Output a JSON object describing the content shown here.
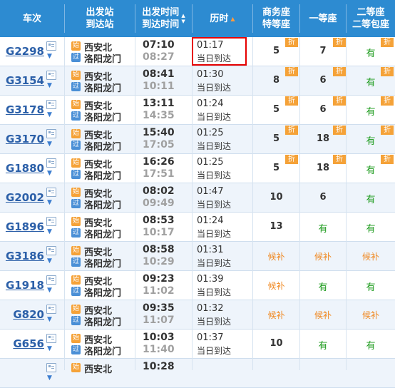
{
  "header": {
    "train_no": "车次",
    "station_l1": "出发站",
    "station_l2": "到达站",
    "time_l1": "出发时间",
    "time_l2": "到达时间",
    "duration": "历时",
    "business_l1": "商务座",
    "business_l2": "特等座",
    "first_class": "一等座",
    "second_l1": "二等座",
    "second_l2": "二等包座"
  },
  "badges": {
    "start": "始",
    "via": "过"
  },
  "discount_label": "折",
  "rows": [
    {
      "train": "G2298",
      "from": "西安北",
      "to": "洛阳龙门",
      "dep": "07:10",
      "arr": "08:27",
      "dur": "01:17",
      "arrive_day": "当日到达",
      "business": "5",
      "first": "7",
      "second": "有",
      "disc_b": true,
      "disc_f": true,
      "disc_s": true
    },
    {
      "train": "G3154",
      "from": "西安北",
      "to": "洛阳龙门",
      "dep": "08:41",
      "arr": "10:11",
      "dur": "01:30",
      "arrive_day": "当日到达",
      "business": "8",
      "first": "6",
      "second": "有",
      "disc_b": true,
      "disc_f": true,
      "disc_s": true
    },
    {
      "train": "G3178",
      "from": "西安北",
      "to": "洛阳龙门",
      "dep": "13:11",
      "arr": "14:35",
      "dur": "01:24",
      "arrive_day": "当日到达",
      "business": "5",
      "first": "6",
      "second": "有",
      "disc_b": true,
      "disc_f": true,
      "disc_s": true
    },
    {
      "train": "G3170",
      "from": "西安北",
      "to": "洛阳龙门",
      "dep": "15:40",
      "arr": "17:05",
      "dur": "01:25",
      "arrive_day": "当日到达",
      "business": "5",
      "first": "18",
      "second": "有",
      "disc_b": true,
      "disc_f": true,
      "disc_s": true
    },
    {
      "train": "G1880",
      "from": "西安北",
      "to": "洛阳龙门",
      "dep": "16:26",
      "arr": "17:51",
      "dur": "01:25",
      "arrive_day": "当日到达",
      "business": "5",
      "first": "18",
      "second": "有",
      "disc_b": true,
      "disc_f": true,
      "disc_s": true
    },
    {
      "train": "G2002",
      "from": "西安北",
      "to": "洛阳龙门",
      "dep": "08:02",
      "arr": "09:49",
      "dur": "01:47",
      "arrive_day": "当日到达",
      "business": "10",
      "first": "6",
      "second": "有",
      "disc_b": false,
      "disc_f": false,
      "disc_s": false
    },
    {
      "train": "G1896",
      "from": "西安北",
      "to": "洛阳龙门",
      "dep": "08:53",
      "arr": "10:17",
      "dur": "01:24",
      "arrive_day": "当日到达",
      "business": "13",
      "first": "有",
      "second": "有",
      "disc_b": false,
      "disc_f": false,
      "disc_s": false
    },
    {
      "train": "G3186",
      "from": "西安北",
      "to": "洛阳龙门",
      "dep": "08:58",
      "arr": "10:29",
      "dur": "01:31",
      "arrive_day": "当日到达",
      "business": "候补",
      "first": "候补",
      "second": "候补",
      "disc_b": false,
      "disc_f": false,
      "disc_s": false
    },
    {
      "train": "G1918",
      "from": "西安北",
      "to": "洛阳龙门",
      "dep": "09:23",
      "arr": "11:02",
      "dur": "01:39",
      "arrive_day": "当日到达",
      "business": "候补",
      "first": "有",
      "second": "有",
      "disc_b": false,
      "disc_f": false,
      "disc_s": false
    },
    {
      "train": "G820",
      "from": "西安北",
      "to": "洛阳龙门",
      "dep": "09:35",
      "arr": "11:07",
      "dur": "01:32",
      "arrive_day": "当日到达",
      "business": "候补",
      "first": "候补",
      "second": "候补",
      "disc_b": false,
      "disc_f": false,
      "disc_s": false
    },
    {
      "train": "G656",
      "from": "西安北",
      "to": "洛阳龙门",
      "dep": "10:03",
      "arr": "11:40",
      "dur": "01:37",
      "arrive_day": "当日到达",
      "business": "10",
      "first": "有",
      "second": "有",
      "disc_b": false,
      "disc_f": false,
      "disc_s": false
    },
    {
      "train": "",
      "from": "西安北",
      "to": "",
      "dep": "10:28",
      "arr": "",
      "dur": "",
      "arrive_day": "",
      "business": "",
      "first": "",
      "second": "",
      "disc_b": false,
      "disc_f": false,
      "disc_s": false
    }
  ]
}
